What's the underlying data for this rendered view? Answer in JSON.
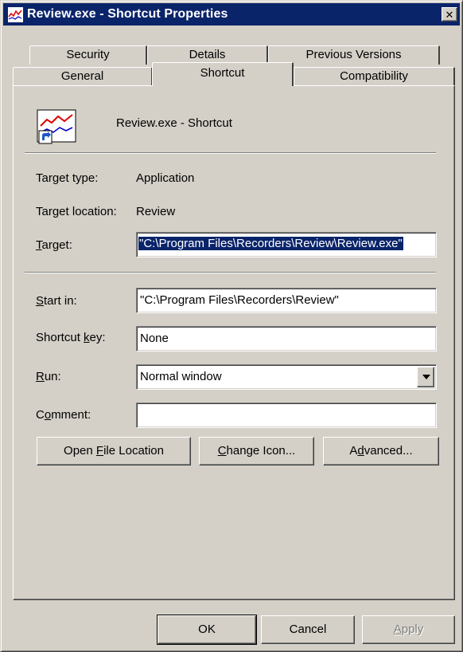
{
  "window": {
    "title": "Review.exe - Shortcut Properties",
    "close_label": "✕"
  },
  "tabs_back": [
    {
      "label": "Security"
    },
    {
      "label": "Details"
    },
    {
      "label": "Previous Versions"
    }
  ],
  "tabs_front": [
    {
      "label": "General"
    },
    {
      "label": "Shortcut",
      "active": true
    },
    {
      "label": "Compatibility"
    }
  ],
  "shortcut": {
    "name": "Review.exe - Shortcut",
    "icon": "chart-shortcut-icon",
    "target_type_label": "Target type:",
    "target_type_value": "Application",
    "target_location_label": "Target location:",
    "target_location_value": "Review",
    "target_label": {
      "pre": "",
      "mnemonic": "T",
      "post": "arget:"
    },
    "target_value": "\"C:\\Program Files\\Recorders\\Review\\Review.exe\"",
    "start_in_label": {
      "pre": "",
      "mnemonic": "S",
      "post": "tart in:"
    },
    "start_in_value": "\"C:\\Program Files\\Recorders\\Review\"",
    "shortcut_key_label": {
      "pre": "Shortcut ",
      "mnemonic": "k",
      "post": "ey:"
    },
    "shortcut_key_value": "None",
    "run_label": {
      "pre": "",
      "mnemonic": "R",
      "post": "un:"
    },
    "run_value": "Normal window",
    "comment_label": {
      "pre": "C",
      "mnemonic": "o",
      "post": "mment:"
    },
    "comment_value": ""
  },
  "action_buttons": {
    "open_file_location": {
      "pre": "Open ",
      "mnemonic": "F",
      "post": "ile Location"
    },
    "change_icon": {
      "pre": "",
      "mnemonic": "C",
      "post": "hange Icon..."
    },
    "advanced": {
      "pre": "A",
      "mnemonic": "d",
      "post": "vanced..."
    }
  },
  "dialog_buttons": {
    "ok": "OK",
    "cancel": "Cancel",
    "apply": {
      "pre": "",
      "mnemonic": "A",
      "post": "pply"
    }
  },
  "colors": {
    "titlebar": "#0a246a",
    "face": "#d4d0c8",
    "selection": "#0a246a"
  }
}
